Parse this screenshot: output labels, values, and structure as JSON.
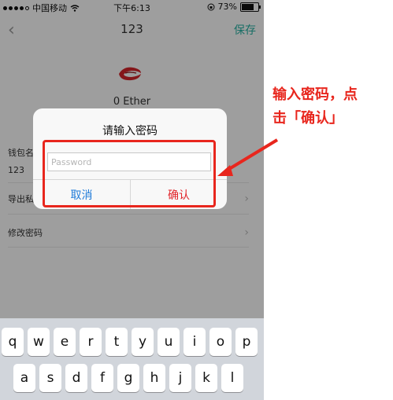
{
  "status_bar": {
    "carrier": "中国移动",
    "time": "下午6:13",
    "battery": "73%",
    "battery_level": 0.73
  },
  "nav": {
    "title": "123",
    "save_label": "保存"
  },
  "wallet": {
    "balance": "0 Ether"
  },
  "rows": [
    {
      "label": "钱包名",
      "value": "123"
    },
    {
      "label": "导出私钥"
    },
    {
      "label": "修改密码"
    }
  ],
  "dialog": {
    "title": "请输入密码",
    "password_placeholder": "Password",
    "cancel_label": "取消",
    "confirm_label": "确认"
  },
  "keyboard": {
    "row1": [
      "q",
      "w",
      "e",
      "r",
      "t",
      "y",
      "u",
      "i",
      "o",
      "p"
    ],
    "row2": [
      "a",
      "s",
      "d",
      "f",
      "g",
      "h",
      "j",
      "k",
      "l"
    ]
  },
  "annotation": {
    "line1": "输入密码，点",
    "line2": "击「确认」",
    "color": "#e8261d"
  },
  "colors": {
    "accent": "#27b2a3",
    "cancel": "#1f7bd9",
    "confirm": "#e1242a"
  }
}
